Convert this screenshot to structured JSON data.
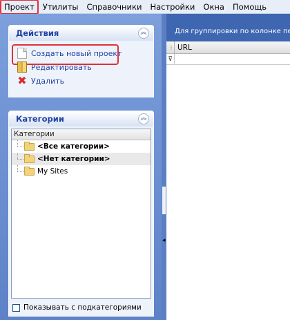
{
  "menu": {
    "items": [
      "Проект",
      "Утилиты",
      "Справочники",
      "Настройки",
      "Окна",
      "Помощь"
    ]
  },
  "actions_panel": {
    "title": "Действия",
    "collapse_glyph": "︽",
    "items": [
      {
        "label": "Создать новый проект",
        "icon": "new-document-icon"
      },
      {
        "label": "Редактировать",
        "icon": "edit-icon"
      },
      {
        "label": "Удалить",
        "icon": "delete-icon"
      }
    ]
  },
  "categories_panel": {
    "title": "Категории",
    "collapse_glyph": "︽",
    "column_header": "Категории",
    "tree": [
      {
        "label": "<Все категории>",
        "bold": true
      },
      {
        "label": "<Нет категории>",
        "bold": true
      },
      {
        "label": "My Sites",
        "bold": false
      }
    ],
    "show_subcategories_label": "Показывать с подкатегориями",
    "show_subcategories_checked": false
  },
  "grid": {
    "group_hint": "Для группировки по колонке пере",
    "columns": [
      "URL"
    ],
    "corner_glyph": "⋮",
    "filter_glyph": "⊽"
  },
  "splitter": {
    "arrow_glyph": "◂"
  }
}
